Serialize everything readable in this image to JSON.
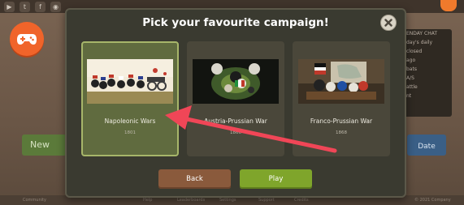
{
  "modal": {
    "title": "Pick your favourite campaign!",
    "close_icon": "close-icon",
    "campaigns": [
      {
        "name": "Napoleonic Wars",
        "year": "1801",
        "selected": true
      },
      {
        "name": "Austria-Prussian War",
        "year": "1866",
        "selected": false
      },
      {
        "name": "Franco-Prussian War",
        "year": "1868",
        "selected": false
      }
    ],
    "back_label": "Back",
    "play_label": "Play"
  },
  "background": {
    "new_button_label": "New",
    "side_button_label": "Date",
    "side_panel_lines": [
      "ENDAY CHAT",
      "day's daily",
      "closed",
      "ago",
      "bats",
      "A/S",
      "attle",
      "nt"
    ],
    "social_icons": [
      "youtube-icon",
      "twitter-icon",
      "facebook-icon",
      "discord-icon"
    ],
    "footer_links": [
      "Community",
      "Help",
      "Leaderboards",
      "Settings",
      "Support",
      "Credits",
      "© 2021 Company"
    ]
  },
  "annotation": {
    "arrow_color": "#f04657"
  },
  "colors": {
    "selected_card": "#606b3f",
    "play_button": "#7fa52b",
    "back_button": "#8a5a3c",
    "modal_bg": "#3a3a30"
  }
}
